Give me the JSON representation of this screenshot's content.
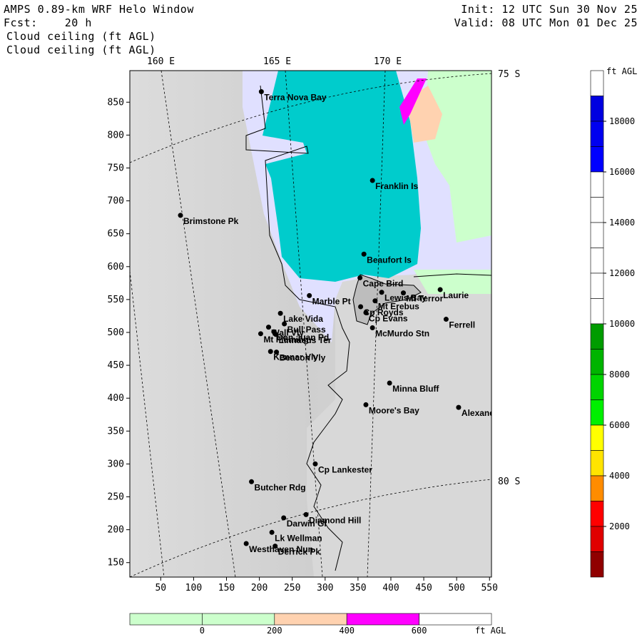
{
  "header": {
    "line1": "AMPS 0.89-km WRF Helo Window",
    "line2": "Fcst:    20 h",
    "line3": "Cloud ceiling (ft AGL)",
    "line4": "Cloud ceiling (ft AGL)",
    "init": "Init: 12 UTC Sun 30 Nov 25",
    "valid": "Valid: 08 UTC Mon 01 Dec 25"
  },
  "map": {
    "lon_labels": [
      "160 E",
      "165 E",
      "170 E"
    ],
    "lat_labels": [
      "75 S",
      "80 S"
    ],
    "x_ticks": [
      "50",
      "100",
      "150",
      "200",
      "250",
      "300",
      "350",
      "400",
      "450",
      "500",
      "550"
    ],
    "y_ticks": [
      "850",
      "800",
      "750",
      "700",
      "650",
      "600",
      "550",
      "500",
      "450",
      "400",
      "350",
      "300",
      "250",
      "200",
      "150"
    ],
    "places": [
      {
        "name": "Terra Nova Bay",
        "x": 203,
        "y": 866
      },
      {
        "name": "Franklin Is",
        "x": 372,
        "y": 731
      },
      {
        "name": "Brimstone Pk",
        "x": 80,
        "y": 678
      },
      {
        "name": "Beaufort Is",
        "x": 359,
        "y": 619
      },
      {
        "name": "Cape Bird",
        "x": 353,
        "y": 583
      },
      {
        "name": "Lewis Bay",
        "x": 386,
        "y": 561
      },
      {
        "name": "Laurie",
        "x": 475,
        "y": 565
      },
      {
        "name": "Mt Terror",
        "x": 419,
        "y": 560
      },
      {
        "name": "Marble Pt",
        "x": 276,
        "y": 556
      },
      {
        "name": "Mt Erebus",
        "x": 376,
        "y": 548
      },
      {
        "name": "Cp Royds",
        "x": 354,
        "y": 539
      },
      {
        "name": "Lake Vida",
        "x": 232,
        "y": 529
      },
      {
        "name": "Cp Evans",
        "x": 362,
        "y": 530
      },
      {
        "name": "Ferrell",
        "x": 484,
        "y": 520
      },
      {
        "name": "Wall Vly",
        "x": 214,
        "y": 508
      },
      {
        "name": "Bull Pass",
        "x": 238,
        "y": 513
      },
      {
        "name": "McMurdo Stn",
        "x": 372,
        "y": 507
      },
      {
        "name": "Don Juan Pd",
        "x": 222,
        "y": 501
      },
      {
        "name": "Mt Fleming",
        "x": 202,
        "y": 498
      },
      {
        "name": "Linnaeus Ter",
        "x": 225,
        "y": 497
      },
      {
        "name": "Kennar Vly",
        "x": 217,
        "y": 471
      },
      {
        "name": "Beacon Vly",
        "x": 226,
        "y": 470
      },
      {
        "name": "Minna Bluff",
        "x": 398,
        "y": 423
      },
      {
        "name": "Moore's Bay",
        "x": 362,
        "y": 390
      },
      {
        "name": "Alexander",
        "x": 503,
        "y": 386
      },
      {
        "name": "Cp Lankester",
        "x": 285,
        "y": 300
      },
      {
        "name": "Butcher Rdg",
        "x": 188,
        "y": 273
      },
      {
        "name": "Diamond Hill",
        "x": 271,
        "y": 223
      },
      {
        "name": "Darwin Gl",
        "x": 237,
        "y": 218
      },
      {
        "name": "Lk Wellman",
        "x": 219,
        "y": 196
      },
      {
        "name": "Westhaven Nun",
        "x": 180,
        "y": 179
      },
      {
        "name": "Derrick Pk",
        "x": 224,
        "y": 175
      }
    ]
  },
  "colorbar_right": {
    "unit": "ft AGL",
    "labels": [
      "18000",
      "16000",
      "14000",
      "12000",
      "10000",
      "8000",
      "6000",
      "4000",
      "2000"
    ],
    "colors": [
      "#ffffff",
      "#0000e0",
      "#0000f0",
      "#0000ff",
      "#ffffff",
      "#ffffff",
      "#ffffff",
      "#ffffff",
      "#ffffff",
      "#ffffff",
      "#009c00",
      "#00b400",
      "#00d400",
      "#00f000",
      "#ffff00",
      "#ffe400",
      "#ff8c00",
      "#ff0000",
      "#e00000",
      "#900000"
    ]
  },
  "colorbar_bottom": {
    "unit": "ft AGL",
    "labels": [
      "0",
      "200",
      "400",
      "600"
    ],
    "colors": [
      "#ccffcc",
      "#ccffcc",
      "#ffd2b0",
      "#ff00ff",
      "#ffffff"
    ]
  }
}
